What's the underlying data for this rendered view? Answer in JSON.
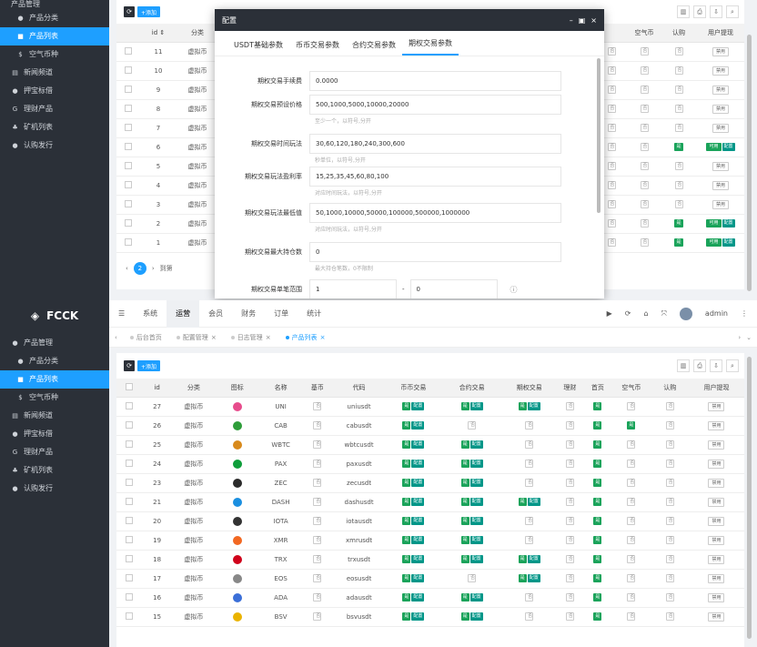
{
  "brand": {
    "name": "FCCK"
  },
  "sidebar_top": {
    "items": [
      {
        "label": "产品分类"
      },
      {
        "label": "产品列表"
      },
      {
        "label": "空气币种"
      },
      {
        "label": "新闻频道"
      },
      {
        "label": "押宝标借"
      },
      {
        "label": "理财产品"
      },
      {
        "label": "矿机列表"
      },
      {
        "label": "认购发行"
      }
    ],
    "header": "产品管理"
  },
  "sidebar": {
    "items": [
      {
        "label": "产品管理"
      },
      {
        "label": "产品分类"
      },
      {
        "label": "产品列表"
      },
      {
        "label": "空气币种"
      },
      {
        "label": "新闻频道"
      },
      {
        "label": "押宝标借"
      },
      {
        "label": "理财产品"
      },
      {
        "label": "矿机列表"
      },
      {
        "label": "认购发行"
      }
    ]
  },
  "topnav": {
    "items": [
      "系统",
      "运营",
      "会员",
      "财务",
      "订单",
      "统计"
    ],
    "user": "admin"
  },
  "tabs": [
    "后台首页",
    "配置管理",
    "日志管理",
    "产品列表"
  ],
  "toolbar": {
    "add": "+添加"
  },
  "columns": [
    "id",
    "分类",
    "图标",
    "名称",
    "基币",
    "代码",
    "币币交易",
    "合约交易",
    "期权交易",
    "理财",
    "首页",
    "空气币",
    "认购",
    "用户提现"
  ],
  "rows": [
    {
      "id": "27",
      "cat": "虚拟币",
      "name": "UNI",
      "code": "uniusdt",
      "color": "#e74c8c"
    },
    {
      "id": "26",
      "cat": "虚拟币",
      "name": "CAB",
      "code": "cabusdt",
      "color": "#2e9d3a"
    },
    {
      "id": "25",
      "cat": "虚拟币",
      "name": "WBTC",
      "code": "wbtcusdt",
      "color": "#d88a1c"
    },
    {
      "id": "24",
      "cat": "虚拟币",
      "name": "PAX",
      "code": "paxusdt",
      "color": "#0f9e3b"
    },
    {
      "id": "23",
      "cat": "虚拟币",
      "name": "ZEC",
      "code": "zecusdt",
      "color": "#2b2b2b"
    },
    {
      "id": "21",
      "cat": "虚拟币",
      "name": "DASH",
      "code": "dashusdt",
      "color": "#1b8fe0"
    },
    {
      "id": "20",
      "cat": "虚拟币",
      "name": "IOTA",
      "code": "iotausdt",
      "color": "#333333"
    },
    {
      "id": "19",
      "cat": "虚拟币",
      "name": "XMR",
      "code": "xmrusdt",
      "color": "#f26822"
    },
    {
      "id": "18",
      "cat": "虚拟币",
      "name": "TRX",
      "code": "trxusdt",
      "color": "#d0021b"
    },
    {
      "id": "17",
      "cat": "虚拟币",
      "name": "EOS",
      "code": "eosusdt",
      "color": "#888888"
    },
    {
      "id": "16",
      "cat": "虚拟币",
      "name": "ADA",
      "code": "adausdt",
      "color": "#3b6fd8"
    },
    {
      "id": "15",
      "cat": "虚拟币",
      "name": "BSV",
      "code": "bsvusdt",
      "color": "#eab300"
    }
  ],
  "bg_rows": [
    {
      "id": "11",
      "cat": "虚拟币"
    },
    {
      "id": "10",
      "cat": "虚拟币"
    },
    {
      "id": "9",
      "cat": "虚拟币"
    },
    {
      "id": "8",
      "cat": "虚拟币"
    },
    {
      "id": "7",
      "cat": "虚拟币"
    },
    {
      "id": "6",
      "cat": "虚拟币"
    },
    {
      "id": "5",
      "cat": "虚拟币"
    },
    {
      "id": "4",
      "cat": "虚拟币"
    },
    {
      "id": "3",
      "cat": "虚拟币"
    },
    {
      "id": "2",
      "cat": "虚拟币"
    },
    {
      "id": "1",
      "cat": "虚拟币"
    }
  ],
  "labels": {
    "on": "是",
    "off": "否",
    "cfg": "配置",
    "ban": "禁用",
    "use": "可用"
  },
  "pager": {
    "page": "2",
    "goto": "到第"
  },
  "modal": {
    "title": "配置",
    "tabs": [
      "USDT基础参数",
      "币币交易参数",
      "合约交易参数",
      "期权交易参数"
    ],
    "fields": [
      {
        "label": "期权交易手续费",
        "value": "0.0000",
        "hint": ""
      },
      {
        "label": "期权交易预设价格",
        "value": "500,1000,5000,10000,20000",
        "hint": "至少一个，以符号,分开"
      },
      {
        "label": "期权交易时间玩法",
        "value": "30,60,120,180,240,300,600",
        "hint": "秒单位，以符号,分开"
      },
      {
        "label": "期权交易玩法盈利率",
        "value": "15,25,35,45,60,80,100",
        "hint": "对应时间玩法，以符号,分开"
      },
      {
        "label": "期权交易玩法最低值",
        "value": "50,1000,10000,50000,100000,500000,1000000",
        "hint": "对应时间玩法，以符号,分开"
      },
      {
        "label": "期权交易最大持仓数",
        "value": "0",
        "hint": "最大持仓笔数，0不限制"
      },
      {
        "label": "期权交易单笔范围",
        "value": "1",
        "value2": "0",
        "hint": ""
      }
    ]
  }
}
